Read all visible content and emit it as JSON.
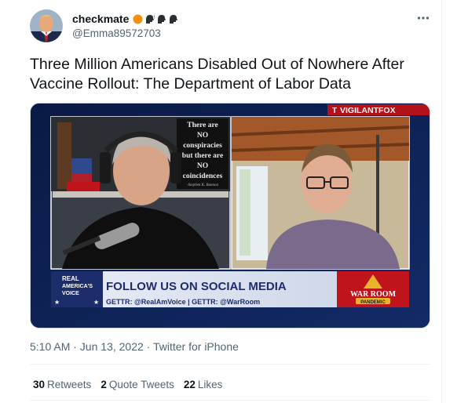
{
  "tweet": {
    "display_name": "checkmate",
    "handle": "@Emma89572703",
    "text": "Three Million Americans Disabled Out of Nowhere After Vaccine Rollout: The Department of Labor Data",
    "timestamp": "5:10 AM · Jun 13, 2022",
    "source": "Twitter for iPhone",
    "more_icon": "more-horizontal-icon",
    "emojis": [
      "orange-circle-icon",
      "speaking-head-icon",
      "speaking-head-icon",
      "speaking-head-icon"
    ]
  },
  "video": {
    "watermark": "VIGILANTFOX",
    "sign_lines": [
      "There are",
      "NO",
      "conspiracies",
      "but there are",
      "NO",
      "coincidences",
      "-Stephen K. Bannon"
    ],
    "banner_title": "FOLLOW US ON SOCIAL MEDIA",
    "banner_sub": "GETTR: @RealAmVoice | GETTR: @WarRoom",
    "logo_lines": [
      "REAL",
      "AMERICA'S",
      "VOICE"
    ],
    "warroom_title": "WAR ROOM",
    "warroom_sub": "PANDEMIC"
  },
  "stats": {
    "retweets_count": "30",
    "retweets_label": "Retweets",
    "quotes_count": "2",
    "quotes_label": "Quote Tweets",
    "likes_count": "22",
    "likes_label": "Likes"
  },
  "colors": {
    "text_primary": "#0f1419",
    "text_secondary": "#536471",
    "divider": "#eff3f4",
    "banner_bg": "#1d2d6b",
    "warroom_red": "#c0141c"
  }
}
